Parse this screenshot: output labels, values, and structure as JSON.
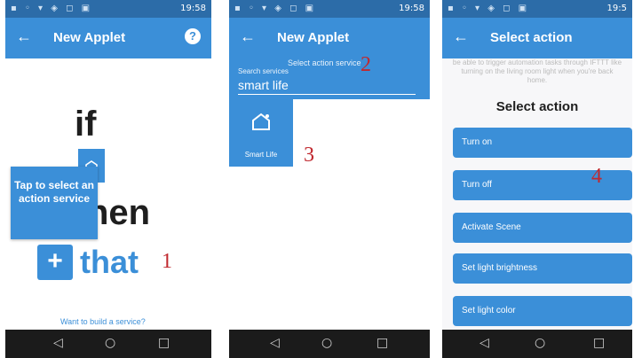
{
  "statusbar": {
    "icons": "▪ ◦ ▾ ◈ ◻ ▣",
    "right_icons": "✱ ⇆ ▼ ▮",
    "time": "19:58",
    "time_partial": "19:5"
  },
  "nav": {
    "back": "◁",
    "home": "○",
    "recent": "□"
  },
  "panel1": {
    "title": "New Applet",
    "help": "?",
    "if_word": "if",
    "then_word": "hen",
    "tooltip": "Tap to select an action service",
    "plus": "+",
    "that_label": "that",
    "step": "1",
    "link": "Want to build a service?"
  },
  "panel2": {
    "title": "New Applet",
    "heading": "Select action service",
    "search_label": "Search services",
    "search_value": "smart life",
    "tile_label": "Smart Life",
    "step_a": "2",
    "step_b": "3"
  },
  "panel3": {
    "title": "Select action",
    "description": "be able to trigger automation tasks through IFTTT like turning on the living room light when you're back home.",
    "heading": "Select action",
    "step": "4",
    "actions": [
      "Turn on",
      "Turn off",
      "Activate Scene",
      "Set light brightness",
      "Set light color"
    ]
  },
  "colors": {
    "accent": "#3b8fd8",
    "statusbar": "#2c6ca8",
    "step": "#c0282e"
  }
}
